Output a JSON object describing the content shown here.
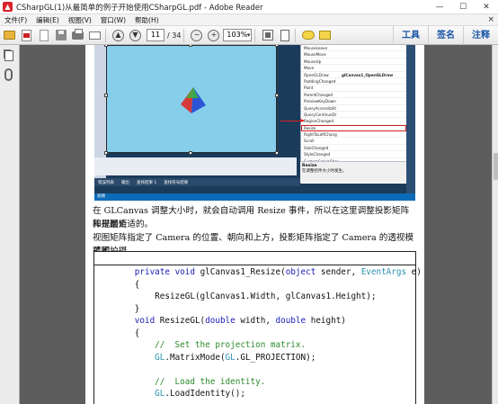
{
  "window": {
    "title": "CSharpGL(1)从最简单的例子开始使用CSharpGL.pdf - Adobe Reader",
    "minimize": "—",
    "maximize": "☐",
    "close": "✕"
  },
  "menu": {
    "items": [
      "文件(F)",
      "编辑(E)",
      "视图(V)",
      "窗口(W)",
      "帮助(H)"
    ],
    "close": "×"
  },
  "toolbar": {
    "page_current": "11",
    "page_total": "/ 34",
    "zoom": "103%",
    "links": [
      "工具",
      "签名",
      "注释"
    ]
  },
  "screenshot": {
    "properties": [
      {
        "name": "MouseLeave",
        "value": ""
      },
      {
        "name": "MouseMove",
        "value": ""
      },
      {
        "name": "MouseUp",
        "value": ""
      },
      {
        "name": "Move",
        "value": ""
      },
      {
        "name": "OpenGLDraw",
        "value": "glCanvas1_OpenGLDraw"
      },
      {
        "name": "PaddingChanged",
        "value": ""
      },
      {
        "name": "Paint",
        "value": ""
      },
      {
        "name": "ParentChanged",
        "value": ""
      },
      {
        "name": "PreviewKeyDown",
        "value": ""
      },
      {
        "name": "QueryAccessibilit",
        "value": ""
      },
      {
        "name": "QueryContinueDr",
        "value": ""
      },
      {
        "name": "RegionChanged",
        "value": ""
      },
      {
        "name": "Resize",
        "value": ""
      },
      {
        "name": "RightToLeftChang",
        "value": ""
      },
      {
        "name": "Scroll",
        "value": ""
      },
      {
        "name": "SizeChanged",
        "value": ""
      },
      {
        "name": "StyleChanged",
        "value": ""
      },
      {
        "name": "SystemColorsChar",
        "value": ""
      }
    ],
    "desc_title": "Resize",
    "desc_text": "在调整控件大小时发生。",
    "tabs": [
      "错误列表",
      "输出",
      "查找结果 1",
      "查找符号结果"
    ],
    "status": "就绪"
  },
  "document": {
    "para1_line1": "在 GLCanvas 调整大小时，就会自动调用 Resize 事件，所以在这里调整投影矩阵和视图矩",
    "para1_line2": "阵是最合适的。",
    "para2_line1": "视图矩阵指定了 Camera 的位置、朝向和上方，投影矩阵指定了 Camera 的透视模式和拍摄",
    "para2_line2": "范围。"
  },
  "code": {
    "line1": [
      {
        "t": "        ",
        "c": ""
      },
      {
        "t": "private",
        "c": "kw"
      },
      {
        "t": " ",
        "c": ""
      },
      {
        "t": "void",
        "c": "kw"
      },
      {
        "t": " glCanvas1_Resize(",
        "c": ""
      },
      {
        "t": "object",
        "c": "kw"
      },
      {
        "t": " sender, ",
        "c": ""
      },
      {
        "t": "EventArgs",
        "c": "ty"
      },
      {
        "t": " e)",
        "c": ""
      }
    ],
    "line2": [
      {
        "t": "        {",
        "c": ""
      }
    ],
    "line3": [
      {
        "t": "            ResizeGL(glCanvas1.Width, glCanvas1.Height);",
        "c": ""
      }
    ],
    "line4": [
      {
        "t": "        }",
        "c": ""
      }
    ],
    "line5": [
      {
        "t": "        ",
        "c": ""
      },
      {
        "t": "void",
        "c": "kw"
      },
      {
        "t": " ResizeGL(",
        "c": ""
      },
      {
        "t": "double",
        "c": "kw"
      },
      {
        "t": " width, ",
        "c": ""
      },
      {
        "t": "double",
        "c": "kw"
      },
      {
        "t": " height)",
        "c": ""
      }
    ],
    "line6": [
      {
        "t": "        {",
        "c": ""
      }
    ],
    "line7": [
      {
        "t": "            //  Set the projection matrix.",
        "c": "cm"
      }
    ],
    "line8": [
      {
        "t": "            ",
        "c": ""
      },
      {
        "t": "GL",
        "c": "ty"
      },
      {
        "t": ".MatrixMode(",
        "c": ""
      },
      {
        "t": "GL",
        "c": "ty"
      },
      {
        "t": ".GL_PROJECTION);",
        "c": ""
      }
    ],
    "line9": [
      {
        "t": "",
        "c": ""
      }
    ],
    "line10": [
      {
        "t": "            //  Load the identity.",
        "c": "cm"
      }
    ],
    "line11": [
      {
        "t": "            ",
        "c": ""
      },
      {
        "t": "GL",
        "c": "ty"
      },
      {
        "t": ".LoadIdentity();",
        "c": ""
      }
    ]
  },
  "colors": {
    "accent": "#1a57a6",
    "keyword": "#1a1ab4",
    "type": "#2b91af",
    "comment": "#2c8a2c",
    "canvas": "#87ceeb"
  }
}
